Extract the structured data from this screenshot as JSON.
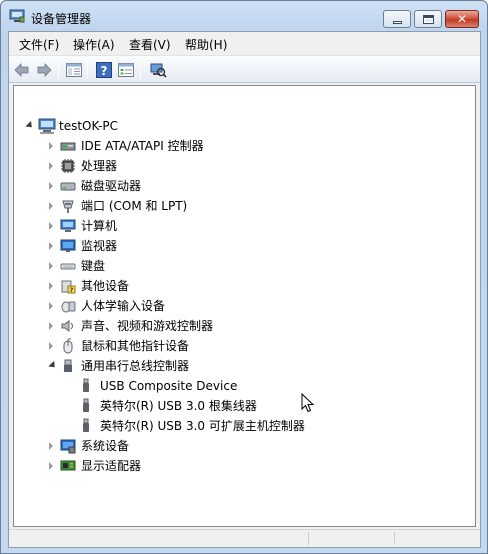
{
  "window": {
    "title": "设备管理器",
    "close_glyph": "✕"
  },
  "menu": {
    "items": [
      "文件(F)",
      "操作(A)",
      "查看(V)",
      "帮助(H)"
    ]
  },
  "toolbar": {
    "icons": [
      "back-arrow-icon",
      "forward-arrow-icon",
      "show-hide-console-tree-icon",
      "help-icon",
      "properties-icon",
      "scan-hardware-icon"
    ]
  },
  "tree": {
    "root": "testOK-PC",
    "categories": [
      {
        "label": "IDE ATA/ATAPI 控制器",
        "icon": "ide-controller-icon"
      },
      {
        "label": "处理器",
        "icon": "processor-icon"
      },
      {
        "label": "磁盘驱动器",
        "icon": "disk-drive-icon"
      },
      {
        "label": "端口 (COM 和 LPT)",
        "icon": "port-icon"
      },
      {
        "label": "计算机",
        "icon": "computer-icon"
      },
      {
        "label": "监视器",
        "icon": "monitor-icon"
      },
      {
        "label": "键盘",
        "icon": "keyboard-icon"
      },
      {
        "label": "其他设备",
        "icon": "other-devices-icon"
      },
      {
        "label": "人体学输入设备",
        "icon": "hid-icon"
      },
      {
        "label": "声音、视频和游戏控制器",
        "icon": "sound-icon"
      },
      {
        "label": "鼠标和其他指针设备",
        "icon": "mouse-icon"
      },
      {
        "label": "通用串行总线控制器",
        "icon": "usb-icon",
        "expanded": true
      },
      {
        "label": "系统设备",
        "icon": "system-devices-icon"
      },
      {
        "label": "显示适配器",
        "icon": "display-adapter-icon"
      }
    ],
    "usb_children": [
      "USB Composite Device",
      "英特尔(R) USB 3.0 根集线器",
      "英特尔(R) USB 3.0 可扩展主机控制器"
    ]
  },
  "colors": {
    "title_bar": "#c4d8ef",
    "close_button": "#c23b22",
    "tree_background": "#ffffff"
  }
}
